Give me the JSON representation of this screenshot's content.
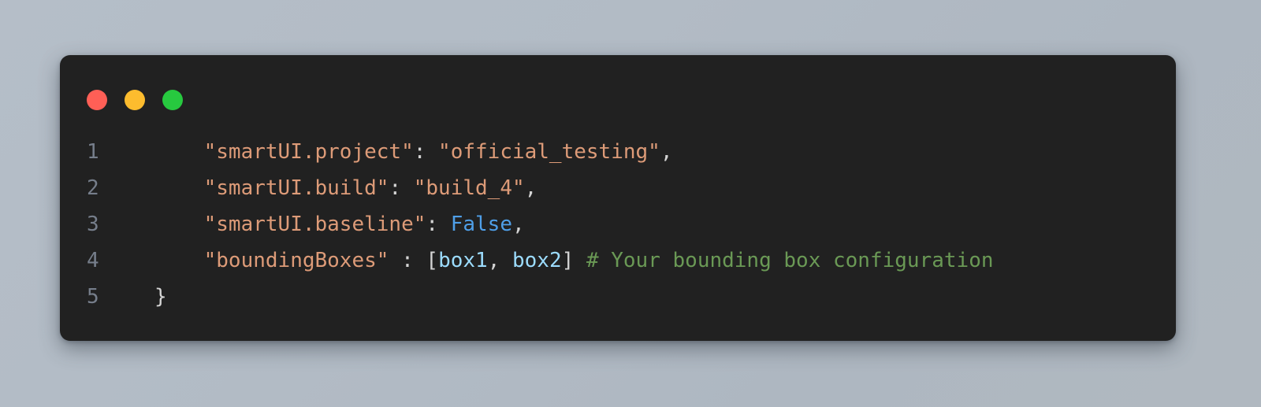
{
  "window": {
    "controls": [
      {
        "name": "close",
        "color": "#ff5f56",
        "label": ""
      },
      {
        "name": "minimize",
        "color": "#fdbc2e",
        "label": ""
      },
      {
        "name": "maximize",
        "color": "#27c93f",
        "label": ""
      }
    ]
  },
  "theme": {
    "background_gradient_start": "#b5bec8",
    "background_gradient_end": "#b0b8c0",
    "card_background": "#212121",
    "line_number_color": "#767e8b",
    "string_color": "#dd9b78",
    "punctuation_color": "#d4d4d4",
    "keyword_color": "#4f9fe8",
    "variable_color": "#9cdcfe",
    "comment_color": "#6a9955"
  },
  "code": {
    "language": "python-dict",
    "lines": [
      {
        "number": "1",
        "text": "    \"smartUI.project\": \"official_testing\",",
        "tokens": [
          {
            "type": "plain",
            "text": "    "
          },
          {
            "type": "string",
            "text": "\"smartUI.project\""
          },
          {
            "type": "punct",
            "text": ": "
          },
          {
            "type": "string",
            "text": "\"official_testing\""
          },
          {
            "type": "punct",
            "text": ","
          }
        ]
      },
      {
        "number": "2",
        "text": "    \"smartUI.build\": \"build_4\",",
        "tokens": [
          {
            "type": "plain",
            "text": "    "
          },
          {
            "type": "string",
            "text": "\"smartUI.build\""
          },
          {
            "type": "punct",
            "text": ": "
          },
          {
            "type": "string",
            "text": "\"build_4\""
          },
          {
            "type": "punct",
            "text": ","
          }
        ]
      },
      {
        "number": "3",
        "text": "    \"smartUI.baseline\": False,",
        "tokens": [
          {
            "type": "plain",
            "text": "    "
          },
          {
            "type": "string",
            "text": "\"smartUI.baseline\""
          },
          {
            "type": "punct",
            "text": ": "
          },
          {
            "type": "keyword",
            "text": "False"
          },
          {
            "type": "punct",
            "text": ","
          }
        ]
      },
      {
        "number": "4",
        "text": "    \"boundingBoxes\" : [box1, box2] # Your bounding box configuration",
        "tokens": [
          {
            "type": "plain",
            "text": "    "
          },
          {
            "type": "string",
            "text": "\"boundingBoxes\""
          },
          {
            "type": "punct",
            "text": " : ["
          },
          {
            "type": "var",
            "text": "box1"
          },
          {
            "type": "punct",
            "text": ", "
          },
          {
            "type": "var",
            "text": "box2"
          },
          {
            "type": "punct",
            "text": "] "
          },
          {
            "type": "comment",
            "text": "# Your bounding box configuration"
          }
        ]
      },
      {
        "number": "5",
        "text": "}",
        "tokens": [
          {
            "type": "punct",
            "text": "}"
          }
        ]
      }
    ]
  }
}
